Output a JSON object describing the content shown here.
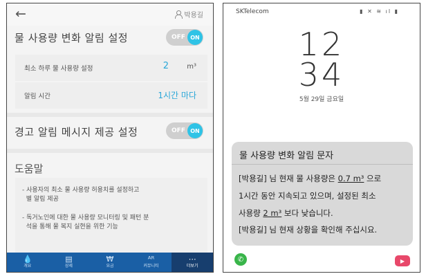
{
  "left": {
    "header": {
      "back_icon": "arrow-left-icon",
      "user_name": "박용길"
    },
    "alert_setting": {
      "title": "물 사용량 변화 알림 설정",
      "toggle_off": "OFF",
      "toggle_on": "ON"
    },
    "min_usage": {
      "label": "최소 하루 물 사용량 설정",
      "value": "2",
      "unit": "m³"
    },
    "alert_time": {
      "label": "알림 시간",
      "value": "1시간 마다"
    },
    "warning_setting": {
      "title": "경고 알림 메시지 제공 설정",
      "toggle_off": "OFF",
      "toggle_on": "ON"
    },
    "help": {
      "title": "도움말",
      "items": [
        "- 사용자의 최소 물 사용량 허용치를 설정하고\n  별 알림 제공",
        "- 독거노인에 대한 물 사용량 모니터링 및 패턴 분\n  석을 통해 물 복지 실현을 위한 기능"
      ]
    },
    "tabs": [
      {
        "label": "개요",
        "icon": "water-drop-icon"
      },
      {
        "label": "상세",
        "icon": "list-icon"
      },
      {
        "label": "요금",
        "icon": "bill-icon"
      },
      {
        "label": "커뮤니티",
        "icon": "community-icon"
      },
      {
        "label": "더보기",
        "icon": "more-icon"
      }
    ],
    "active_tab": 4
  },
  "right": {
    "status": {
      "carrier": "SKTelecom",
      "icons": "▮ ✕ ≋ ıl ▮"
    },
    "clock": {
      "hour": "12",
      "minute": "34"
    },
    "date": "5월 29일 금요일",
    "message": {
      "title": "물 사용량 변화 알림 문자",
      "line1_a": "[박용길] 님 현재 물 사용량은 ",
      "line1_u": "0.7 m³",
      "line1_b": " 으로",
      "line2": "1시간 동안 지속되고 있으며, 설정된 최소",
      "line3_a": "사용량 ",
      "line3_u": "2 m³",
      "line3_b": " 보다 낮습니다.",
      "line4_a": "[박용길] 님 ",
      "line4_b": "현재 상황을 확인해",
      "line4_c": " 주십시요."
    },
    "icons": {
      "call": "phone-icon",
      "video": "video-icon"
    }
  },
  "colors": {
    "accent": "#2fc3e6",
    "tabbar": "#1a5fa5",
    "tab_active": "#173e6e",
    "value_blue": "#2aa7d8"
  }
}
